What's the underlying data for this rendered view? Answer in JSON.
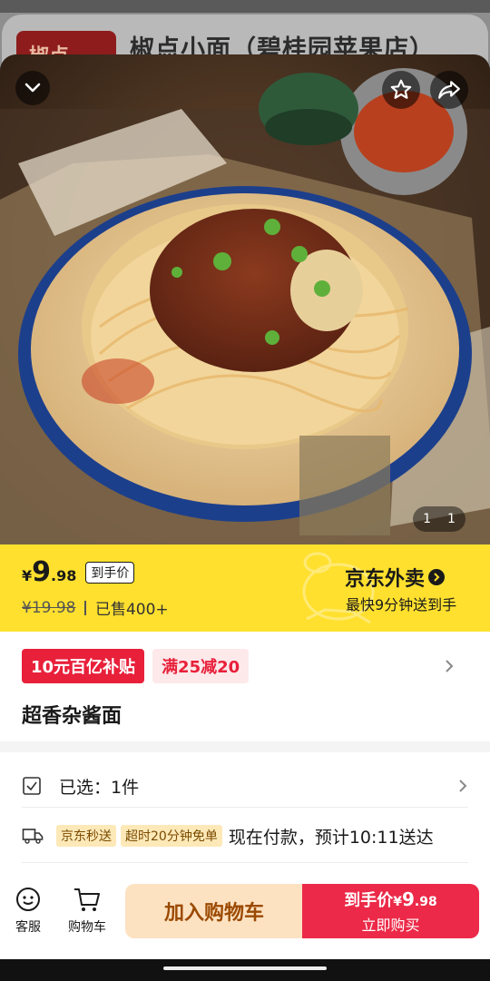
{
  "underlay": {
    "logo_text": "椒点",
    "store_title": "椒点小面（碧桂园苹果店）"
  },
  "hero": {
    "page_current": "1",
    "page_total": "1"
  },
  "price": {
    "currency": "¥",
    "integer": "9",
    "decimal": ".98",
    "tag": "到手价",
    "original": "¥19.98",
    "sold": "已售400+"
  },
  "brand": {
    "name": "京东外卖",
    "subtitle": "最快9分钟送到手"
  },
  "promos": [
    "10元百亿补贴",
    "满25减20"
  ],
  "product": {
    "name": "超香杂酱面"
  },
  "selection": {
    "label": "已选：1件"
  },
  "delivery": {
    "tags": [
      "京东秒送",
      "超时20分钟免单"
    ],
    "text": "现在付款，预计10:11送达"
  },
  "bottom": {
    "service": "客服",
    "cart": "购物车",
    "add_cart": "加入购物车",
    "buy_prefix": "到手价",
    "buy_currency": "¥",
    "buy_int": "9",
    "buy_dec": ".98",
    "buy_now": "立即购买"
  },
  "colors": {
    "price_band": "#ffe02e",
    "accent_red": "#e8203a",
    "buy_button": "#ec2948",
    "cart_button": "#fde2c2"
  }
}
